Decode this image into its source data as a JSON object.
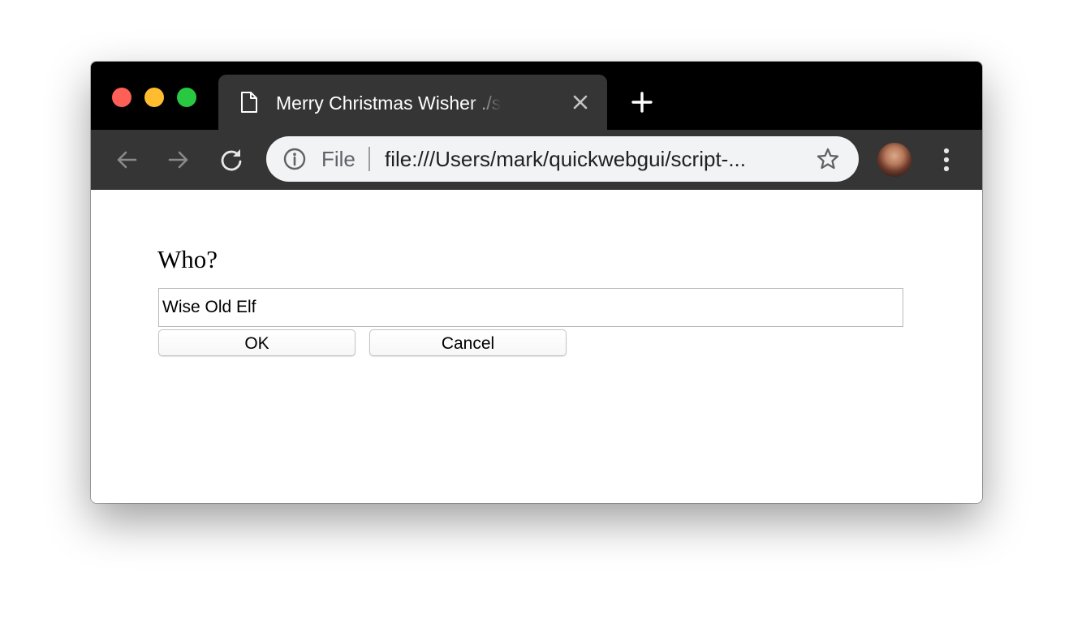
{
  "window": {
    "controls": [
      "close",
      "minimize",
      "maximize"
    ]
  },
  "tab": {
    "title": "Merry Christmas Wisher ./script-",
    "icon": "document-icon",
    "close_icon": "close-icon"
  },
  "new_tab_icon": "plus-icon",
  "toolbar": {
    "back_icon": "back-arrow-icon",
    "forward_icon": "forward-arrow-icon",
    "reload_icon": "reload-icon",
    "info_icon": "info-icon",
    "scheme_label": "File",
    "url": "file:///Users/mark/quickwebgui/script-...",
    "bookmark_icon": "star-icon",
    "profile_icon": "avatar",
    "menu_icon": "kebab-menu-icon"
  },
  "page": {
    "prompt": "Who?",
    "input_value": "Wise Old Elf",
    "ok_label": "OK",
    "cancel_label": "Cancel"
  },
  "colors": {
    "titlebar": "#000000",
    "toolbar": "#353535",
    "omnibox": "#f1f3f4",
    "traffic_close": "#fe5f57",
    "traffic_minimize": "#febc2e",
    "traffic_maximize": "#28c840"
  }
}
